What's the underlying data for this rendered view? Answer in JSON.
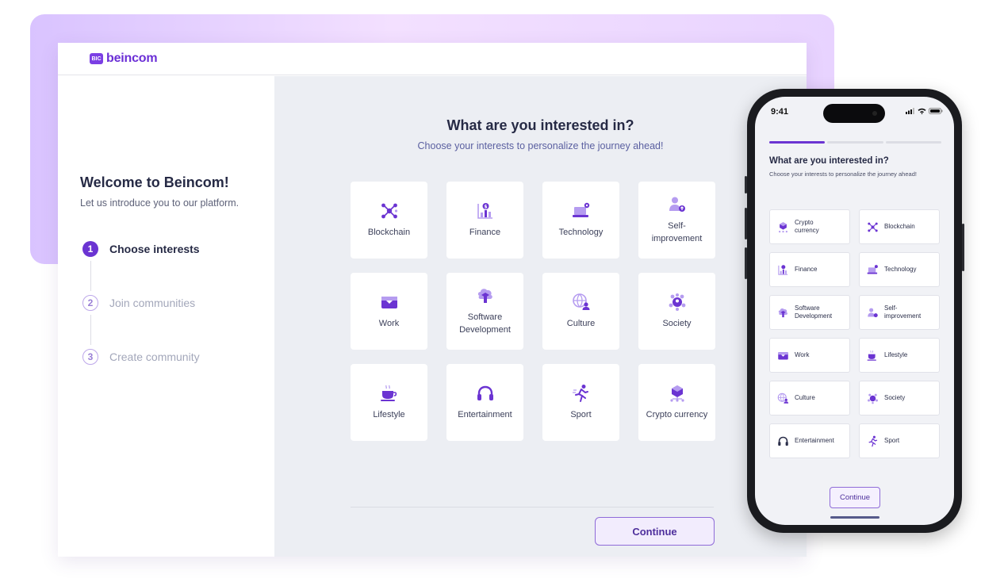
{
  "brand": {
    "logo_badge": "BIC",
    "name": "beincom",
    "accent": "#6b34d2"
  },
  "sidebar": {
    "title": "Welcome to Beincom!",
    "subtitle": "Let us introduce you to our platform.",
    "steps": [
      {
        "number": "1",
        "label": "Choose interests",
        "state": "active"
      },
      {
        "number": "2",
        "label": "Join communities",
        "state": "inactive"
      },
      {
        "number": "3",
        "label": "Create community",
        "state": "inactive"
      }
    ]
  },
  "main": {
    "title": "What are you interested in?",
    "subtitle": "Choose your interests to personalize the journey ahead!",
    "interests": [
      {
        "label": "Blockchain",
        "icon": "blockchain-icon"
      },
      {
        "label": "Finance",
        "icon": "finance-icon"
      },
      {
        "label": "Technology",
        "icon": "technology-icon"
      },
      {
        "label": "Self-\nimprovement",
        "icon": "self-improvement-icon"
      },
      {
        "label": "Work",
        "icon": "work-icon"
      },
      {
        "label": "Software\nDevelopment",
        "icon": "software-development-icon"
      },
      {
        "label": "Culture",
        "icon": "culture-icon"
      },
      {
        "label": "Society",
        "icon": "society-icon"
      },
      {
        "label": "Lifestyle",
        "icon": "lifestyle-icon"
      },
      {
        "label": "Entertainment",
        "icon": "entertainment-icon"
      },
      {
        "label": "Sport",
        "icon": "sport-icon"
      },
      {
        "label": "Crypto currency",
        "icon": "crypto-currency-icon"
      }
    ],
    "continue_label": "Continue"
  },
  "phone": {
    "time": "9:41",
    "progress": {
      "completed_steps": 1,
      "total_steps": 3
    },
    "title": "What are you interested in?",
    "subtitle": "Choose your interests to personalize the journey ahead!",
    "interests": [
      {
        "label": "Crypto\ncurrency",
        "icon": "crypto-currency-icon"
      },
      {
        "label": "Blockchain",
        "icon": "blockchain-icon"
      },
      {
        "label": "Finance",
        "icon": "finance-icon"
      },
      {
        "label": "Technology",
        "icon": "technology-icon"
      },
      {
        "label": "Software\nDevelopment",
        "icon": "software-development-icon"
      },
      {
        "label": "Self-\nimprovement",
        "icon": "self-improvement-icon"
      },
      {
        "label": "Work",
        "icon": "work-icon"
      },
      {
        "label": "Lifestyle",
        "icon": "lifestyle-icon"
      },
      {
        "label": "Culture",
        "icon": "culture-icon"
      },
      {
        "label": "Society",
        "icon": "society-icon"
      },
      {
        "label": "Entertainment",
        "icon": "entertainment-icon"
      },
      {
        "label": "Sport",
        "icon": "sport-icon"
      }
    ],
    "continue_label": "Continue"
  }
}
